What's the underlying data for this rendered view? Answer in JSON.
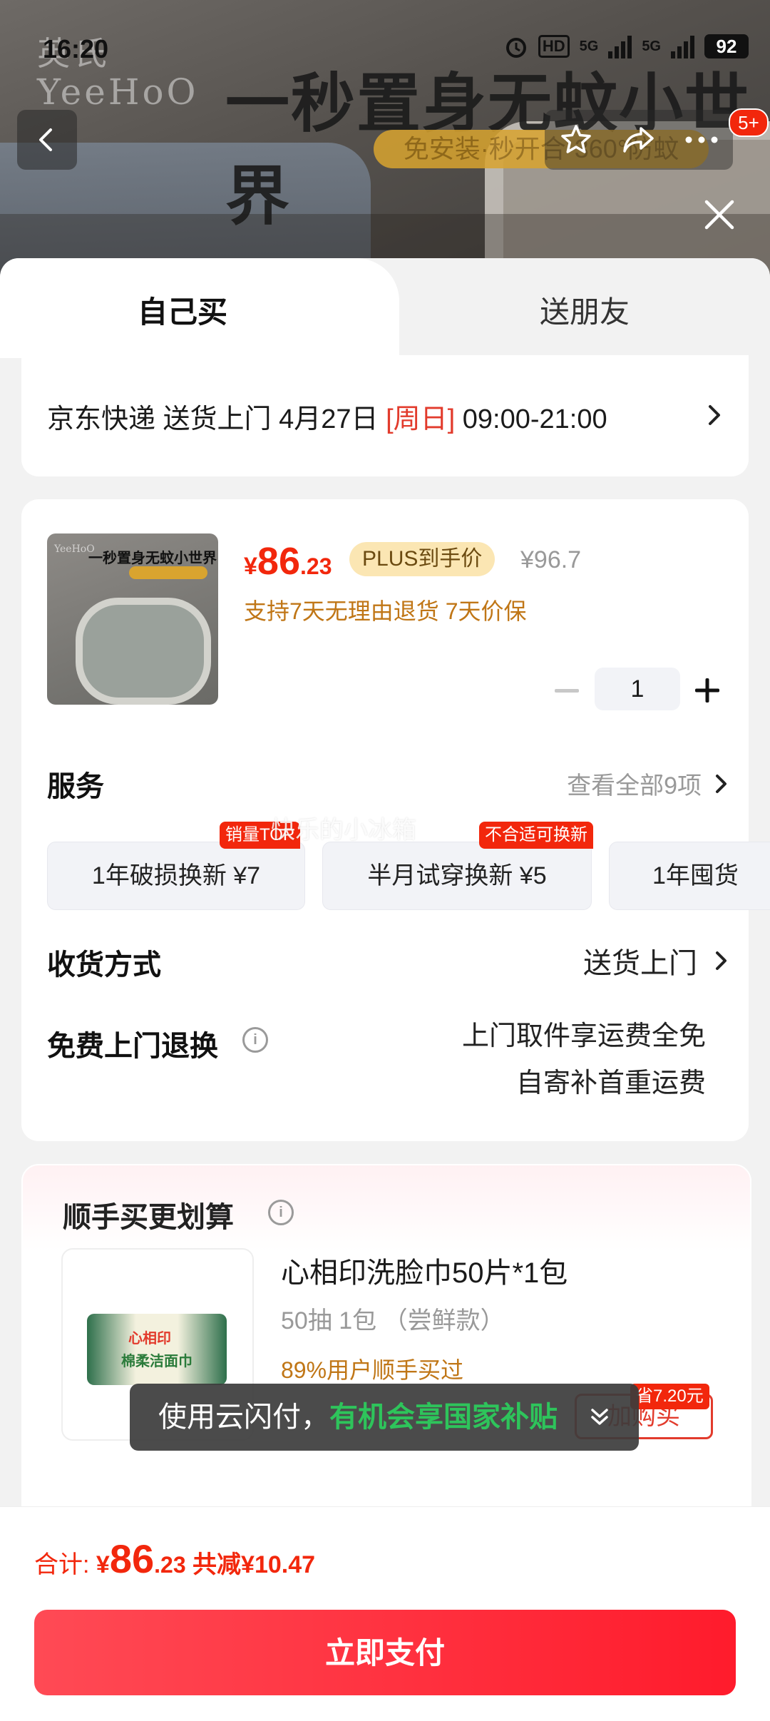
{
  "status_bar": {
    "time": "16:20",
    "hd_label": "HD",
    "net1": "5G",
    "net2": "5G",
    "battery": "92"
  },
  "banner": {
    "brand_cn": "英氏",
    "brand_en": "YeeHoO",
    "slogan": "一秒置身无蚊小世界",
    "pill_text": "免安装·秒开合·360°防蚊"
  },
  "header": {
    "cart_badge": "5+"
  },
  "tabs": [
    {
      "label": "自己买"
    },
    {
      "label": "送朋友"
    }
  ],
  "delivery": {
    "prefix": "京东快递 送货上门 4月27日 ",
    "day": "[周日]",
    "time_range": " 09:00-21:00"
  },
  "product": {
    "thumb_title": "一秒置身无蚊小世界",
    "thumb_brand": "YeeHoO",
    "price_symbol": "¥",
    "price_int": "86",
    "price_dec": ".23",
    "plus_tag": "PLUS到手价",
    "orig_price": "¥96.7",
    "guarantee": "支持7天无理由退货  7天价保",
    "quantity": "1"
  },
  "services": {
    "title": "服务",
    "view_all": "查看全部9项",
    "items": [
      {
        "label": "1年破损换新  ¥7",
        "badge": "销量TOP"
      },
      {
        "label": "半月试穿换新  ¥5",
        "badge": "不合适可换新"
      },
      {
        "label": "1年囤货",
        "badge": ""
      }
    ],
    "watermark": "快乐的小冰箱"
  },
  "receive": {
    "title": "收货方式",
    "value": "送货上门"
  },
  "free_return": {
    "title": "免费上门退换",
    "line1": "上门取件享运费全免",
    "line2": "自寄补首重运费"
  },
  "addon": {
    "title": "顺手买更划算",
    "name": "心相印洗脸巾50片*1包",
    "spec": "50抽 1包 （尝鲜款）",
    "stat": "89%用户顺手买过",
    "buy_label": "加购买",
    "save_tag": "省7.20元",
    "thumb_brand": "心相印",
    "thumb_text": "棉柔洁面巾"
  },
  "toast": {
    "prefix": "使用云闪付，",
    "highlight": "有机会享国家补贴"
  },
  "footer": {
    "total_label": "合计: ",
    "total_symbol": "¥",
    "total_int": "86",
    "total_dec": ".23",
    "discount": " 共减¥10.47",
    "pay_label": "立即支付"
  },
  "colors": {
    "accent_red": "#f2270c",
    "guarantee_orange": "#c07616",
    "toast_green": "#2ec45b"
  },
  "icons": [
    "back-arrow-icon",
    "star-icon",
    "share-icon",
    "more-icon",
    "close-icon",
    "chevron-right-icon",
    "minus-icon",
    "plus-icon",
    "info-icon",
    "chevron-down-icon"
  ]
}
